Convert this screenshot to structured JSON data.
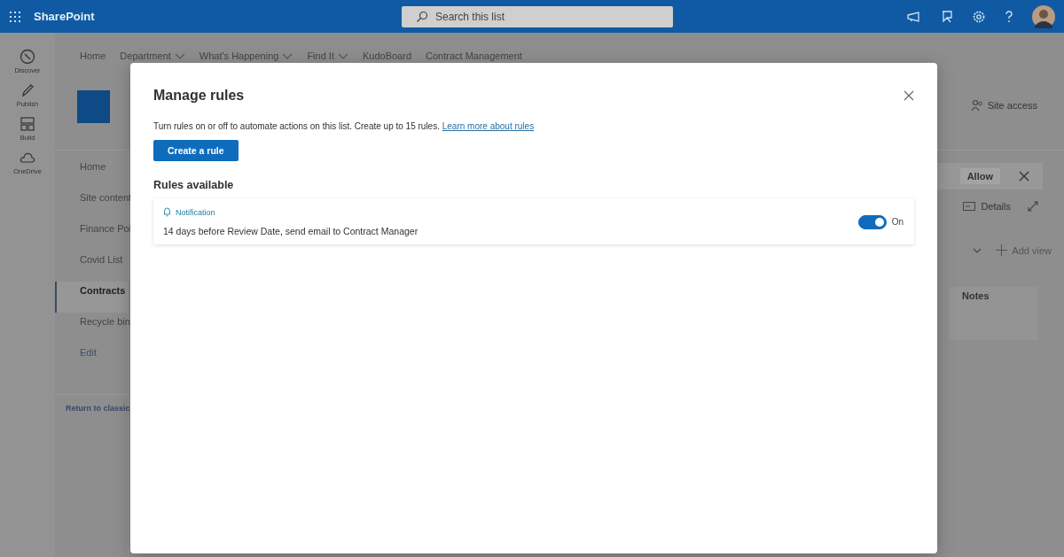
{
  "header": {
    "app_name": "SharePoint",
    "search_placeholder": "Search this list"
  },
  "rail": [
    {
      "label": "Discover",
      "kind": "compass"
    },
    {
      "label": "Publish",
      "kind": "pen"
    },
    {
      "label": "Build",
      "kind": "blocks"
    },
    {
      "label": "OneDrive",
      "kind": "cloud"
    }
  ],
  "top_nav": [
    {
      "label": "Home",
      "has_menu": false
    },
    {
      "label": "Department",
      "has_menu": true
    },
    {
      "label": "What's Happening",
      "has_menu": true
    },
    {
      "label": "Find It",
      "has_menu": true
    },
    {
      "label": "KudoBoard",
      "has_menu": false
    },
    {
      "label": "Contract Management",
      "has_menu": false
    }
  ],
  "left_nav": [
    {
      "label": "Home",
      "selected": false
    },
    {
      "label": "Site content",
      "selected": false
    },
    {
      "label": "Finance Pol",
      "selected": false
    },
    {
      "label": "Covid List",
      "selected": false
    },
    {
      "label": "Contracts",
      "selected": true
    },
    {
      "label": "Recycle bin",
      "selected": false
    },
    {
      "label": "Edit",
      "selected": false
    }
  ],
  "left_nav_footer": "Return to classic",
  "right_panel": {
    "site_access": "Site access",
    "allow_button": "Allow",
    "details": "Details",
    "add_view": "Add view",
    "notes_column": "Notes"
  },
  "dialog": {
    "title": "Manage rules",
    "description": "Turn rules on or off to automate actions on this list. Create up to 15 rules.",
    "link": "Learn more about rules",
    "create_button": "Create a rule",
    "section_title": "Rules available",
    "rules": [
      {
        "type_label": "Notification",
        "text": "14 days before Review Date, send email to Contract Manager",
        "on": true,
        "state_label": "On"
      }
    ]
  }
}
